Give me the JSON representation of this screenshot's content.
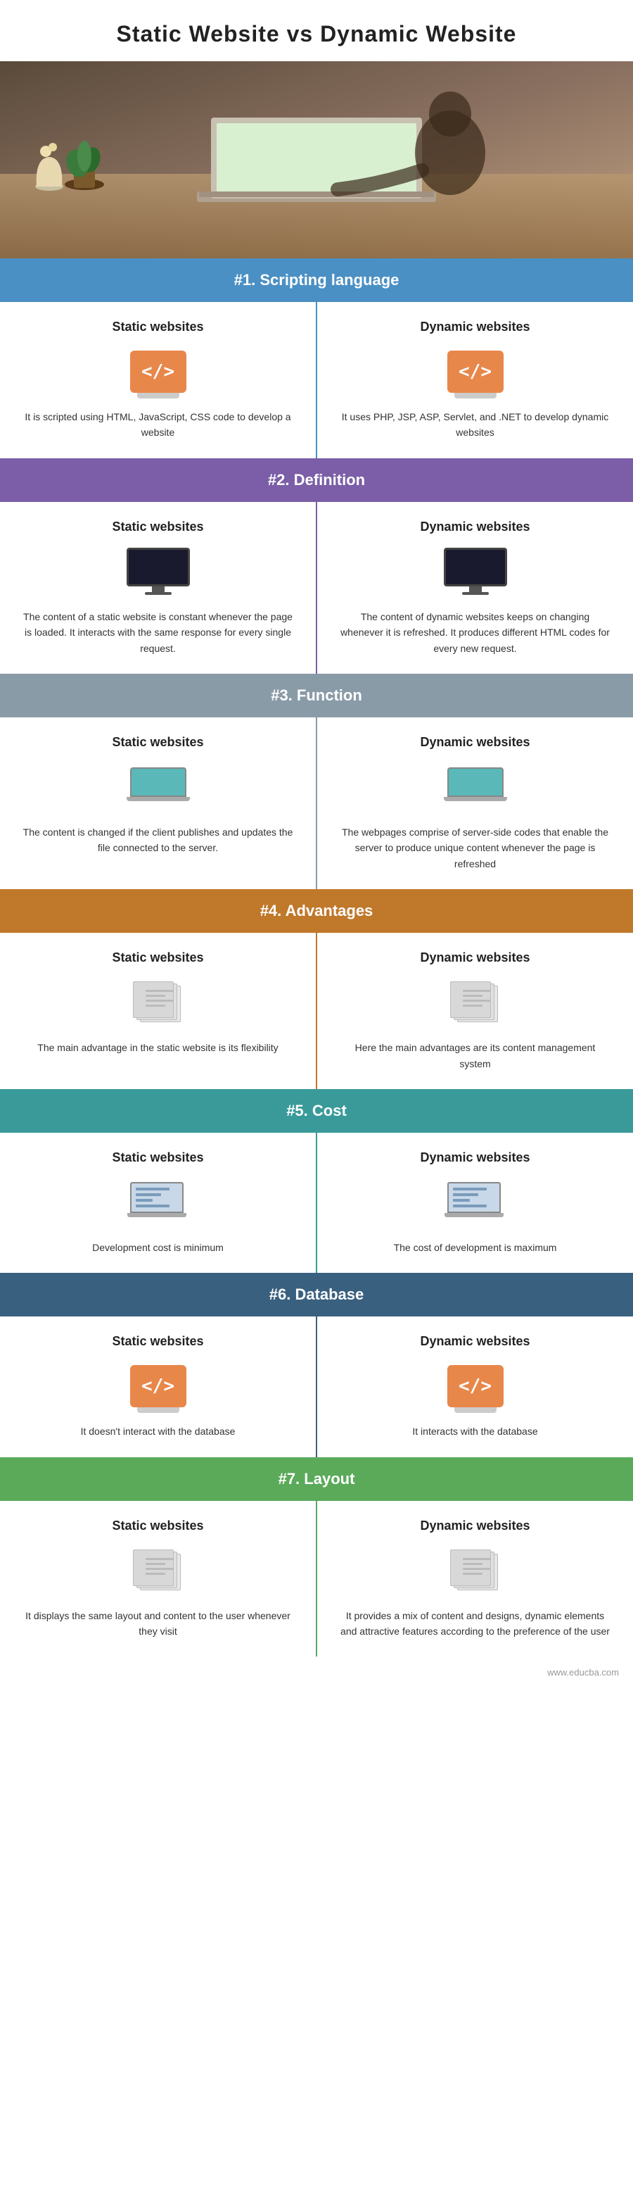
{
  "title": "Static Website vs Dynamic Website",
  "hero": {
    "alt": "Person working on laptop"
  },
  "sections": [
    {
      "id": "scripting",
      "number": "#1.",
      "label": "Scripting language",
      "color": "blue",
      "left": {
        "title": "Static websites",
        "icon": "code",
        "text": "It is scripted using HTML, JavaScript, CSS code to develop a website"
      },
      "right": {
        "title": "Dynamic websites",
        "icon": "code",
        "text": "It uses PHP, JSP, ASP, Servlet, and .NET to develop dynamic websites"
      }
    },
    {
      "id": "definition",
      "number": "#2.",
      "label": "Definition",
      "color": "purple",
      "left": {
        "title": "Static websites",
        "icon": "monitor",
        "text": "The content of a static website is constant whenever the page is loaded. It interacts with the same response for every single request."
      },
      "right": {
        "title": "Dynamic websites",
        "icon": "monitor",
        "text": "The content of dynamic websites keeps on changing whenever it is refreshed. It produces different HTML codes for every new request."
      }
    },
    {
      "id": "function",
      "number": "#3.",
      "label": "Function",
      "color": "gray",
      "left": {
        "title": "Static websites",
        "icon": "laptop-teal",
        "text": "The content is changed if the client publishes and updates the file connected to the server."
      },
      "right": {
        "title": "Dynamic websites",
        "icon": "laptop-teal",
        "text": "The webpages comprise of server-side codes that enable the server to produce unique content whenever the page is refreshed"
      }
    },
    {
      "id": "advantages",
      "number": "#4.",
      "label": "Advantages",
      "color": "brown",
      "left": {
        "title": "Static websites",
        "icon": "files",
        "text": "The main advantage in the static website is its flexibility"
      },
      "right": {
        "title": "Dynamic websites",
        "icon": "files",
        "text": "Here the main advantages are its content management system"
      }
    },
    {
      "id": "cost",
      "number": "#5.",
      "label": "Cost",
      "color": "teal",
      "left": {
        "title": "Static websites",
        "icon": "cost",
        "text": "Development cost is minimum"
      },
      "right": {
        "title": "Dynamic websites",
        "icon": "cost",
        "text": "The cost of development is maximum"
      }
    },
    {
      "id": "database",
      "number": "#6.",
      "label": "Database",
      "color": "dark-blue",
      "left": {
        "title": "Static websites",
        "icon": "code",
        "text": "It doesn't interact with the database"
      },
      "right": {
        "title": "Dynamic websites",
        "icon": "code",
        "text": "It interacts with the database"
      }
    },
    {
      "id": "layout",
      "number": "#7.",
      "label": "Layout",
      "color": "green",
      "left": {
        "title": "Static websites",
        "icon": "files",
        "text": "It displays the same layout and content to the user whenever they visit"
      },
      "right": {
        "title": "Dynamic websites",
        "icon": "files",
        "text": "It provides a mix of content and designs, dynamic elements and attractive features according to the preference of the user"
      }
    }
  ],
  "footer": "www.educba.com",
  "divider_colors": {
    "scripting": "blue",
    "definition": "purple",
    "function": "gray",
    "advantages": "brown",
    "cost": "teal",
    "database": "dark-blue",
    "layout": "green"
  }
}
